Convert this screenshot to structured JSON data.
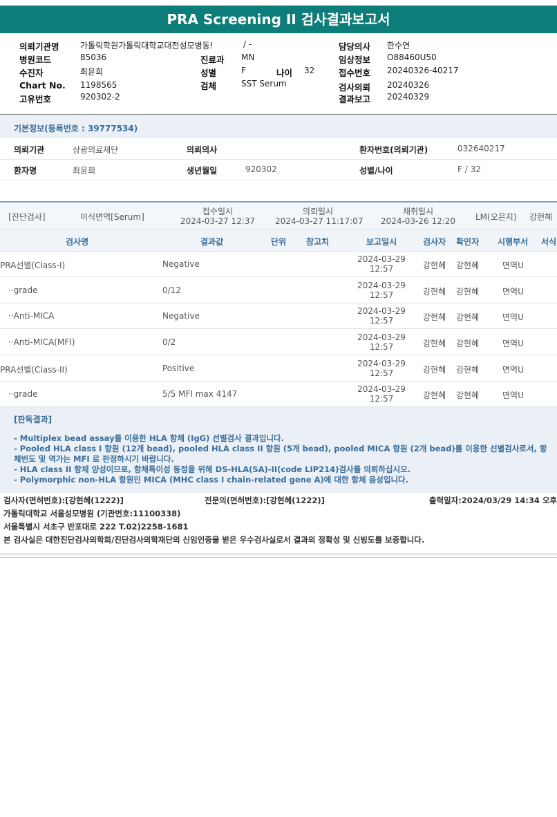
{
  "title": "PRA Screening II 검사결과보고서",
  "header": {
    "institution_label": "의뢰기관명",
    "institution_value": "가톨릭학원가톨릭대학교대전성모병동!",
    "institution_tail": "/ -",
    "hospital_code_label": "병원코드",
    "hospital_code_value": "85036",
    "dept_label": "진료과",
    "dept_value": "MN",
    "patient_label": "수진자",
    "patient_value": "최윤희",
    "sex_label": "성별",
    "sex_value": "F",
    "age_label": "나이",
    "age_value": "32",
    "chart_label": "Chart No.",
    "chart_value": "1198565",
    "specimen_label": "검체",
    "specimen_value": "SST Serum",
    "unique_label": "고유번호",
    "unique_value": "920302-2",
    "doctor_label": "담당의사",
    "doctor_value": "한수연",
    "clinical_label": "임상정보",
    "clinical_value": "O88460U50",
    "reception_label": "접수번호",
    "reception_value": "20240326-40217",
    "request_label": "검사의뢰",
    "request_value": "20240326",
    "report_label": "결과보고",
    "report_value": "20240329"
  },
  "basic": {
    "heading": "기본정보(등록번호 : 39777534)",
    "req_inst_label": "의뢰기관",
    "req_inst_value": "상광의료재단",
    "req_doc_label": "의뢰의사",
    "pat_no_label": "환자번호(의뢰기관)",
    "pat_no_value": "032640217",
    "pat_name_label": "환자명",
    "pat_name_value": "최윤희",
    "birth_label": "생년월일",
    "birth_value": "920302",
    "sexage_label": "성별/나이",
    "sexage_value": "F / 32"
  },
  "order": {
    "category": "[진단검사]",
    "test": "이식면역[Serum]",
    "recv_label": "접수일시",
    "recv_value": "2024-03-27 12:37",
    "req_label": "의뢰일시",
    "req_value": "2024-03-27 11:17:07",
    "col_label": "채취일시",
    "col_value": "2024-03-26 12:20",
    "lm": "LM(오은지)",
    "tester": "강현혜"
  },
  "table": {
    "headers": [
      "검사명",
      "결과값",
      "단위",
      "참고치",
      "보고일시",
      "검사자",
      "확인자",
      "시행부서",
      "서식"
    ],
    "rows": [
      {
        "name": "PRA선별(Class-I)",
        "result": "Negative",
        "date": "2024-03-29",
        "time": "12:57",
        "tester": "강현혜",
        "checker": "강현혜",
        "dept": "면역U"
      },
      {
        "name": "··grade",
        "result": "0/12",
        "date": "2024-03-29",
        "time": "12:57",
        "tester": "강현혜",
        "checker": "강현혜",
        "dept": "면역U"
      },
      {
        "name": "··Anti-MICA",
        "result": "Negative",
        "date": "2024-03-29",
        "time": "12:57",
        "tester": "강현혜",
        "checker": "강현혜",
        "dept": "면역U"
      },
      {
        "name": "··Anti-MICA(MFI)",
        "result": "0/2",
        "date": "2024-03-29",
        "time": "12:57",
        "tester": "강현혜",
        "checker": "강현혜",
        "dept": "면역U"
      },
      {
        "name": "PRA선별(Class-II)",
        "result": "Positive",
        "date": "2024-03-29",
        "time": "12:57",
        "tester": "강현혜",
        "checker": "강현혜",
        "dept": "면역U"
      },
      {
        "name": "··grade",
        "result": "5/5 MFI max 4147",
        "date": "2024-03-29",
        "time": "12:57",
        "tester": "강현혜",
        "checker": "강현혜",
        "dept": "면역U"
      }
    ]
  },
  "judgement": {
    "title": "[판독결과]",
    "lines": [
      "- Multiplex bead assay를 이용한 HLA 항체 (IgG) 선별검사 결과입니다.",
      "- Pooled HLA class I 항원 (12개 bead), pooled HLA class II 항원 (5개 bead), pooled MICA 항원 (2개 bead)를 이용한 선별검사로서, 항체빈도 및 역가는 MFI 로 판정하시기 바랍니다.",
      "- HLA class II 항체 양성이므로, 항체특이성 동정을 위해 DS-HLA(SA)-II(code LIP214)검사를 의뢰하십시오.",
      "- Polymorphic non-HLA 항원인 MICA (MHC class I chain-related gene A)에 대한 항체 음성입니다."
    ]
  },
  "footer": {
    "examiner": "검사자(면허번호):[강현혜(1222)]",
    "specialist": "전문의(면허번호):[강현혜(1222)]",
    "printed": "출력일자:2024/03/29 14:34 오후",
    "hospital": "가톨릭대학교 서울성모병원 (기관번호:11100338)",
    "address": "서울특별시 서초구 반포대로 222 T.02)2258-1681",
    "certification": "본 검사실은 대한진단검사의학회/진단검사의학재단의 신임인증을 받은 우수검사실로서 결과의 정확성 및 신빙도를 보증합니다."
  }
}
